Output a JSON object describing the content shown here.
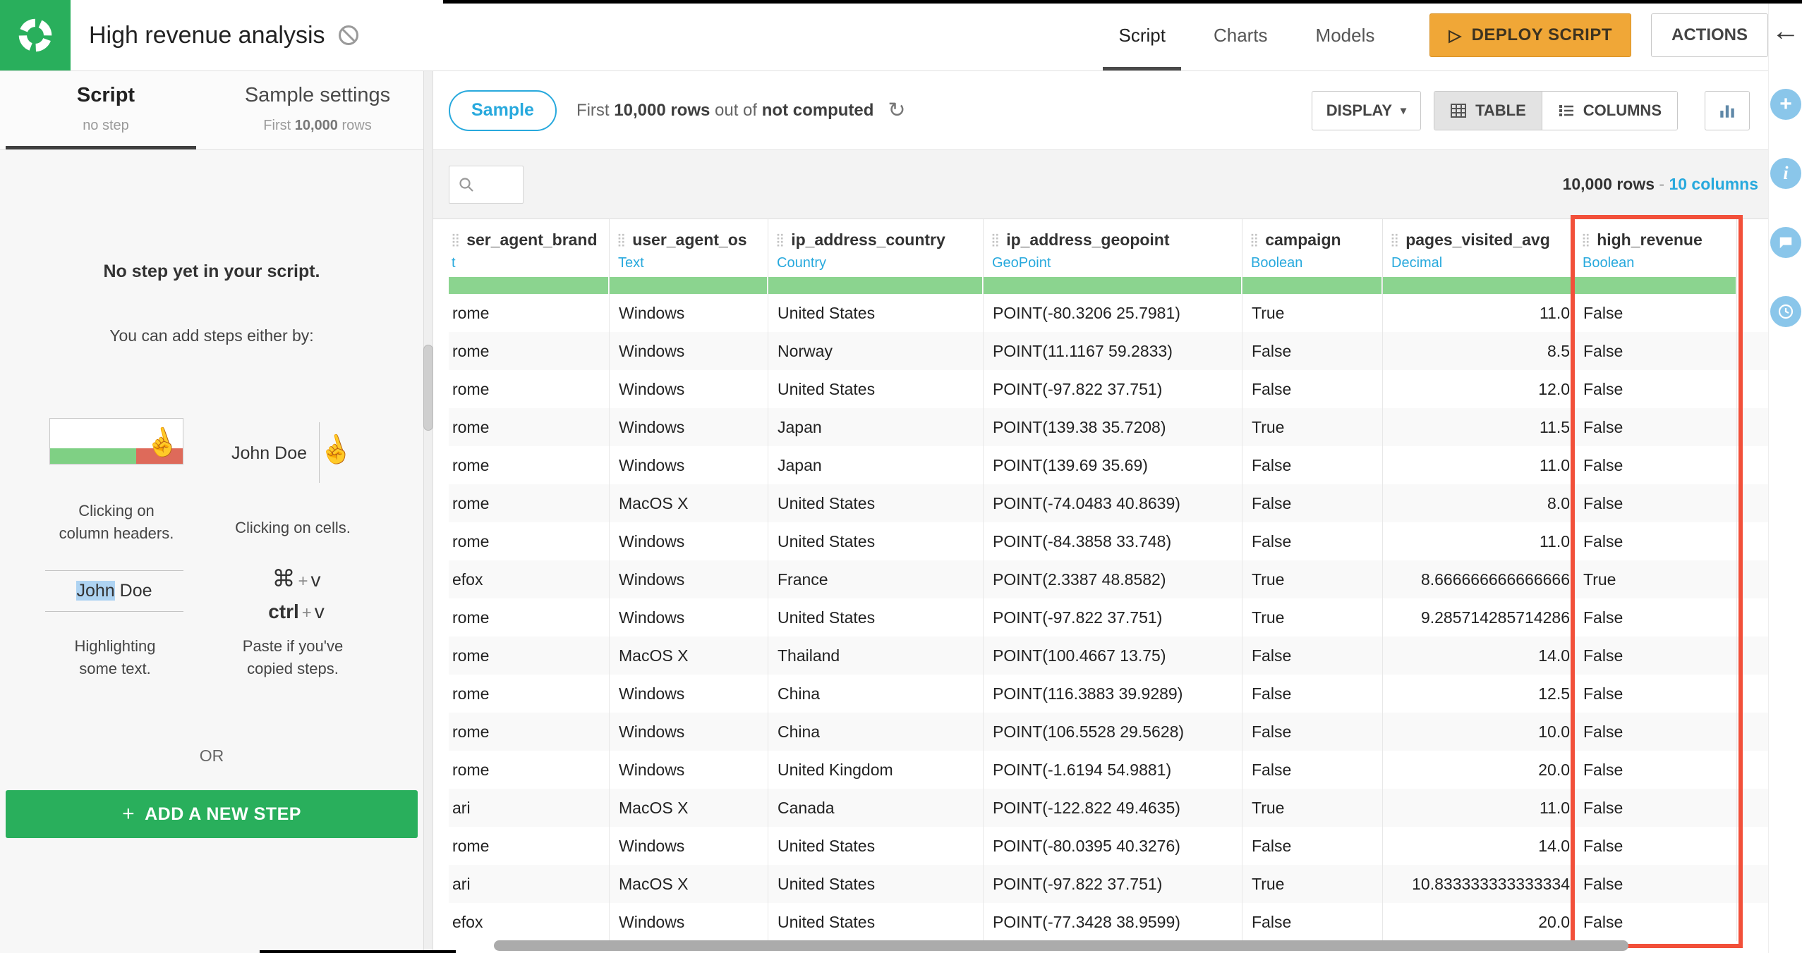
{
  "header": {
    "title": "High revenue analysis",
    "tabs": [
      {
        "label": "Script"
      },
      {
        "label": "Charts"
      },
      {
        "label": "Models"
      }
    ],
    "deploy_label": "DEPLOY SCRIPT",
    "actions_label": "ACTIONS"
  },
  "left_panel": {
    "tab_script": {
      "label": "Script",
      "subtitle": "no step"
    },
    "tab_sample": {
      "label": "Sample settings",
      "subtitle_prefix": "First ",
      "subtitle_bold": "10,000",
      "subtitle_suffix": " rows"
    },
    "empty": {
      "title": "No step yet in your script.",
      "subtitle": "You can add steps either by:",
      "hint_headers_line1": "Clicking on",
      "hint_headers_line2": "column headers.",
      "hint_cells": "Clicking on cells.",
      "cells_sample": "John Doe",
      "highlight_sample_selected": "John",
      "highlight_sample_rest": " Doe",
      "hint_highlight_line1": "Highlighting",
      "hint_highlight_line2": "some text.",
      "hint_paste_line1": "Paste if you've",
      "hint_paste_line2": "copied steps.",
      "kbd_cmd": "⌘",
      "kbd_ctrl": "ctrl",
      "kbd_plus": "+",
      "kbd_v": "v",
      "or_label": "OR",
      "add_step_plus": "+",
      "add_step_label": "ADD A NEW STEP"
    }
  },
  "toolbar": {
    "sample_label": "Sample",
    "status_prefix": "First ",
    "status_rows": "10,000 rows",
    "status_mid": " out of ",
    "status_computed": "not computed",
    "refresh_icon": "↻",
    "display_label": "DISPLAY",
    "display_caret": "▾",
    "table_label": "TABLE",
    "columns_label": "COLUMNS"
  },
  "table": {
    "summary_rows": "10,000 rows",
    "summary_sep": "-",
    "summary_columns": "10 columns",
    "columns": [
      {
        "name": "ser_agent_brand",
        "type": "t",
        "align": "left"
      },
      {
        "name": "user_agent_os",
        "type": "Text",
        "align": "left"
      },
      {
        "name": "ip_address_country",
        "type": "Country",
        "align": "left"
      },
      {
        "name": "ip_address_geopoint",
        "type": "GeoPoint",
        "align": "left"
      },
      {
        "name": "campaign",
        "type": "Boolean",
        "align": "left"
      },
      {
        "name": "pages_visited_avg",
        "type": "Decimal",
        "align": "right"
      },
      {
        "name": "high_revenue",
        "type": "Boolean",
        "align": "left",
        "highlighted": true
      }
    ],
    "rows": [
      [
        "rome",
        "Windows",
        "United States",
        "POINT(-80.3206 25.7981)",
        "True",
        "11.0",
        "False"
      ],
      [
        "rome",
        "Windows",
        "Norway",
        "POINT(11.1167 59.2833)",
        "False",
        "8.5",
        "False"
      ],
      [
        "rome",
        "Windows",
        "United States",
        "POINT(-97.822 37.751)",
        "False",
        "12.0",
        "False"
      ],
      [
        "rome",
        "Windows",
        "Japan",
        "POINT(139.38 35.7208)",
        "True",
        "11.5",
        "False"
      ],
      [
        "rome",
        "Windows",
        "Japan",
        "POINT(139.69 35.69)",
        "False",
        "11.0",
        "False"
      ],
      [
        "rome",
        "MacOS X",
        "United States",
        "POINT(-74.0483 40.8639)",
        "False",
        "8.0",
        "False"
      ],
      [
        "rome",
        "Windows",
        "United States",
        "POINT(-84.3858 33.748)",
        "False",
        "11.0",
        "False"
      ],
      [
        "efox",
        "Windows",
        "France",
        "POINT(2.3387 48.8582)",
        "True",
        "8.666666666666666",
        "True"
      ],
      [
        "rome",
        "Windows",
        "United States",
        "POINT(-97.822 37.751)",
        "True",
        "9.285714285714286",
        "False"
      ],
      [
        "rome",
        "MacOS X",
        "Thailand",
        "POINT(100.4667 13.75)",
        "False",
        "14.0",
        "False"
      ],
      [
        "rome",
        "Windows",
        "China",
        "POINT(116.3883 39.9289)",
        "False",
        "12.5",
        "False"
      ],
      [
        "rome",
        "Windows",
        "China",
        "POINT(106.5528 29.5628)",
        "False",
        "10.0",
        "False"
      ],
      [
        "rome",
        "Windows",
        "United Kingdom",
        "POINT(-1.6194 54.9881)",
        "False",
        "20.0",
        "False"
      ],
      [
        "ari",
        "MacOS X",
        "Canada",
        "POINT(-122.822 49.4635)",
        "True",
        "11.0",
        "False"
      ],
      [
        "rome",
        "Windows",
        "United States",
        "POINT(-80.0395 40.3276)",
        "False",
        "14.0",
        "False"
      ],
      [
        "ari",
        "MacOS X",
        "United States",
        "POINT(-97.822 37.751)",
        "True",
        "10.833333333333334",
        "False"
      ],
      [
        "efox",
        "Windows",
        "United States",
        "POINT(-77.3428 38.9599)",
        "False",
        "20.0",
        "False"
      ]
    ]
  },
  "right_rail": {
    "back_icon": "←",
    "plus_icon": "+",
    "info_icon": "i"
  },
  "colors": {
    "brand_green": "#29AF5C",
    "accent_blue": "#28A9DD",
    "deploy_orange": "#F0A737",
    "highlight_red": "#F2503A",
    "validity_bar_green": "#8BD48F"
  }
}
